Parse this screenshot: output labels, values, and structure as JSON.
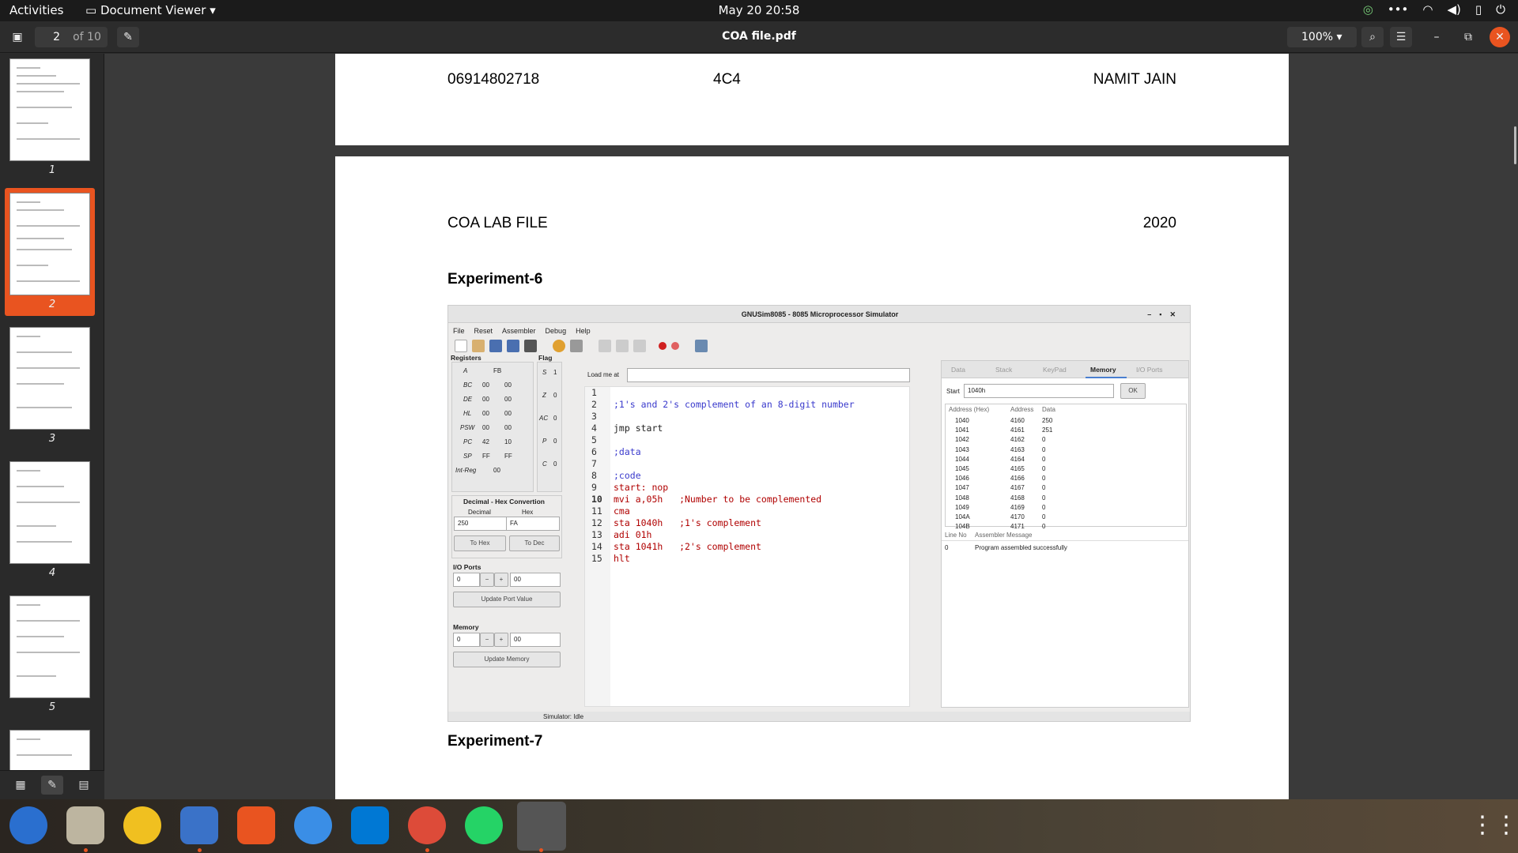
{
  "topbar": {
    "activities": "Activities",
    "app_menu": "Document Viewer ▾",
    "clock": "May 20  20:58"
  },
  "header": {
    "page_current": "2",
    "page_of": "of 10",
    "title": "COA file.pdf",
    "zoom": "100% ▾"
  },
  "sidebar": {
    "thumbnails": [
      {
        "label": "1"
      },
      {
        "label": "2"
      },
      {
        "label": "3"
      },
      {
        "label": "4"
      },
      {
        "label": "5"
      }
    ],
    "selected": "2"
  },
  "page1": {
    "roll": "06914802718",
    "section": "4C4",
    "name": "NAMIT JAIN"
  },
  "page2": {
    "header_left": "COA LAB FILE",
    "header_right": "2020",
    "experiment6": "Experiment-6",
    "experiment7": "Experiment-7",
    "simulator": {
      "title": "GNUSim8085 - 8085 Microprocessor Simulator",
      "menu": [
        "File",
        "Reset",
        "Assembler",
        "Debug",
        "Help"
      ],
      "registers_label": "Registers",
      "flag_label": "Flag",
      "registers": [
        {
          "name": "A",
          "v1": "FB",
          "v2": ""
        },
        {
          "name": "BC",
          "v1": "00",
          "v2": "00"
        },
        {
          "name": "DE",
          "v1": "00",
          "v2": "00"
        },
        {
          "name": "HL",
          "v1": "00",
          "v2": "00"
        },
        {
          "name": "PSW",
          "v1": "00",
          "v2": "00"
        },
        {
          "name": "PC",
          "v1": "42",
          "v2": "10"
        },
        {
          "name": "SP",
          "v1": "FF",
          "v2": "FF"
        },
        {
          "name": "Int-Reg",
          "v1": "00",
          "v2": ""
        }
      ],
      "flags": [
        {
          "name": "S",
          "v": "1"
        },
        {
          "name": "Z",
          "v": "0"
        },
        {
          "name": "AC",
          "v": "0"
        },
        {
          "name": "P",
          "v": "0"
        },
        {
          "name": "C",
          "v": "0"
        }
      ],
      "conv_title": "Decimal - Hex Convertion",
      "decimal_label": "Decimal",
      "hex_label": "Hex",
      "decimal_value": "250",
      "hex_value": "FA",
      "to_hex": "To Hex",
      "to_dec": "To Dec",
      "io_title": "I/O Ports",
      "io_port": "0",
      "io_value": "00",
      "update_port": "Update Port Value",
      "mem_title": "Memory",
      "mem_addr": "0",
      "mem_value": "00",
      "update_mem": "Update Memory",
      "load_label": "Load me at",
      "code_lines": [
        {
          "n": "1",
          "t": ""
        },
        {
          "n": "2",
          "t": ";1's and 2's complement of an 8-digit number"
        },
        {
          "n": "3",
          "t": ""
        },
        {
          "n": "4",
          "t": "jmp start"
        },
        {
          "n": "5",
          "t": ""
        },
        {
          "n": "6",
          "t": ";data"
        },
        {
          "n": "7",
          "t": ""
        },
        {
          "n": "8",
          "t": ";code"
        },
        {
          "n": "9",
          "t": "start: nop"
        },
        {
          "n": "10",
          "t": "mvi a,05h   ;Number to be complemented"
        },
        {
          "n": "11",
          "t": "cma"
        },
        {
          "n": "12",
          "t": "sta 1040h   ;1's complement"
        },
        {
          "n": "13",
          "t": "adi 01h"
        },
        {
          "n": "14",
          "t": "sta 1041h   ;2's complement"
        },
        {
          "n": "15",
          "t": "hlt"
        }
      ],
      "tabs": [
        "Data",
        "Stack",
        "KeyPad",
        "Memory",
        "I/O Ports"
      ],
      "active_tab": "Memory",
      "start_label": "Start",
      "start_value": "1040h",
      "ok": "OK",
      "mem_headers": [
        "Address (Hex)",
        "Address",
        "Data"
      ],
      "mem_rows": [
        [
          "1040",
          "4160",
          "250"
        ],
        [
          "1041",
          "4161",
          "251"
        ],
        [
          "1042",
          "4162",
          "0"
        ],
        [
          "1043",
          "4163",
          "0"
        ],
        [
          "1044",
          "4164",
          "0"
        ],
        [
          "1045",
          "4165",
          "0"
        ],
        [
          "1046",
          "4166",
          "0"
        ],
        [
          "1047",
          "4167",
          "0"
        ],
        [
          "1048",
          "4168",
          "0"
        ],
        [
          "1049",
          "4169",
          "0"
        ],
        [
          "104A",
          "4170",
          "0"
        ],
        [
          "104B",
          "4171",
          "0"
        ]
      ],
      "msg_headers": [
        "Line No",
        "Assembler Message"
      ],
      "msg_line": "0",
      "msg_text": "Program assembled successfully",
      "status": "Simulator: Idle"
    }
  },
  "colors": {
    "accent": "#e95420",
    "comment": "#3a3acc",
    "keyword": "#b00000",
    "number": "#d040d0"
  }
}
